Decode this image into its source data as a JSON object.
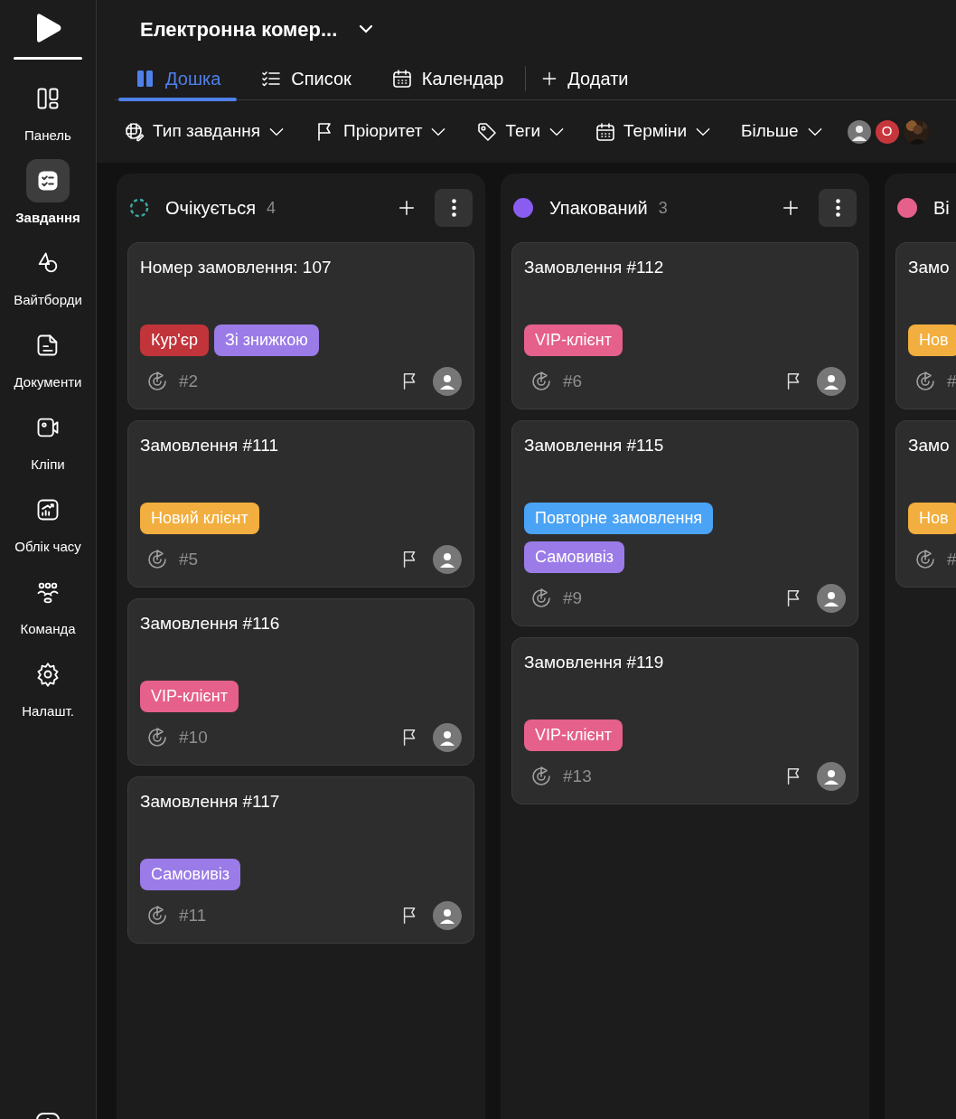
{
  "sidebar": {
    "items": [
      {
        "label": "Панель",
        "selected": false
      },
      {
        "label": "Завдання",
        "selected": true
      },
      {
        "label": "Вайтборди",
        "selected": false
      },
      {
        "label": "Документи",
        "selected": false
      },
      {
        "label": "Кліпи",
        "selected": false
      },
      {
        "label": "Облік часу",
        "selected": false
      },
      {
        "label": "Команда",
        "selected": false
      },
      {
        "label": "Налашт.",
        "selected": false
      }
    ]
  },
  "project": {
    "title": "Електронна комер..."
  },
  "tabs": [
    {
      "label": "Дошка",
      "selected": true
    },
    {
      "label": "Список",
      "selected": false
    },
    {
      "label": "Календар",
      "selected": false
    }
  ],
  "add_view": "Додати",
  "filters": [
    "Тип завдання",
    "Пріоритет",
    "Теги",
    "Терміни",
    "Більше"
  ],
  "avatars": [
    {
      "kind": "user"
    },
    {
      "kind": "initial",
      "text": "O",
      "color": "#c8363d"
    },
    {
      "kind": "picture"
    }
  ],
  "columns": [
    {
      "name": "Очікується",
      "count": "4",
      "kind": "dashed",
      "color": "#3fa9a3",
      "cards": [
        {
          "title": "Номер замовлення: 107",
          "tags": [
            {
              "text": "Кур'єр",
              "color": "#c0343a"
            },
            {
              "text": "Зі знижкою",
              "color": "#9b7be8"
            }
          ],
          "id": "#2"
        },
        {
          "title": "Замовлення #111",
          "tags": [
            {
              "text": "Новий клієнт",
              "color": "#f2ae3e"
            }
          ],
          "id": "#5"
        },
        {
          "title": "Замовлення #116",
          "tags": [
            {
              "text": "VIP-клієнт",
              "color": "#e5608a"
            }
          ],
          "id": "#10"
        },
        {
          "title": "Замовлення #117",
          "tags": [
            {
              "text": "Самовивіз",
              "color": "#9b7be8"
            }
          ],
          "id": "#11"
        }
      ]
    },
    {
      "name": "Упакований",
      "count": "3",
      "kind": "dot",
      "color": "#8b5cf0",
      "cards": [
        {
          "title": "Замовлення #112",
          "tags": [
            {
              "text": "VIP-клієнт",
              "color": "#e5608a"
            }
          ],
          "id": "#6"
        },
        {
          "title": "Замовлення #115",
          "tags": [
            {
              "text": "Повторне замовлення",
              "color": "#4aa3f5"
            },
            {
              "text": "Самовивіз",
              "color": "#9b7be8"
            }
          ],
          "id": "#9"
        },
        {
          "title": "Замовлення #119",
          "tags": [
            {
              "text": "VIP-клієнт",
              "color": "#e5608a"
            }
          ],
          "id": "#13"
        }
      ]
    },
    {
      "name": "Ві",
      "kind": "dot",
      "color": "#e5608a",
      "cards": [
        {
          "title": "Замо",
          "tags": [
            {
              "text": "Нов",
              "color": "#f2ae3e"
            }
          ],
          "id": "#"
        },
        {
          "title": "Замо",
          "tags": [
            {
              "text": "Нов",
              "color": "#f2ae3e"
            }
          ],
          "id": "#"
        }
      ]
    }
  ]
}
